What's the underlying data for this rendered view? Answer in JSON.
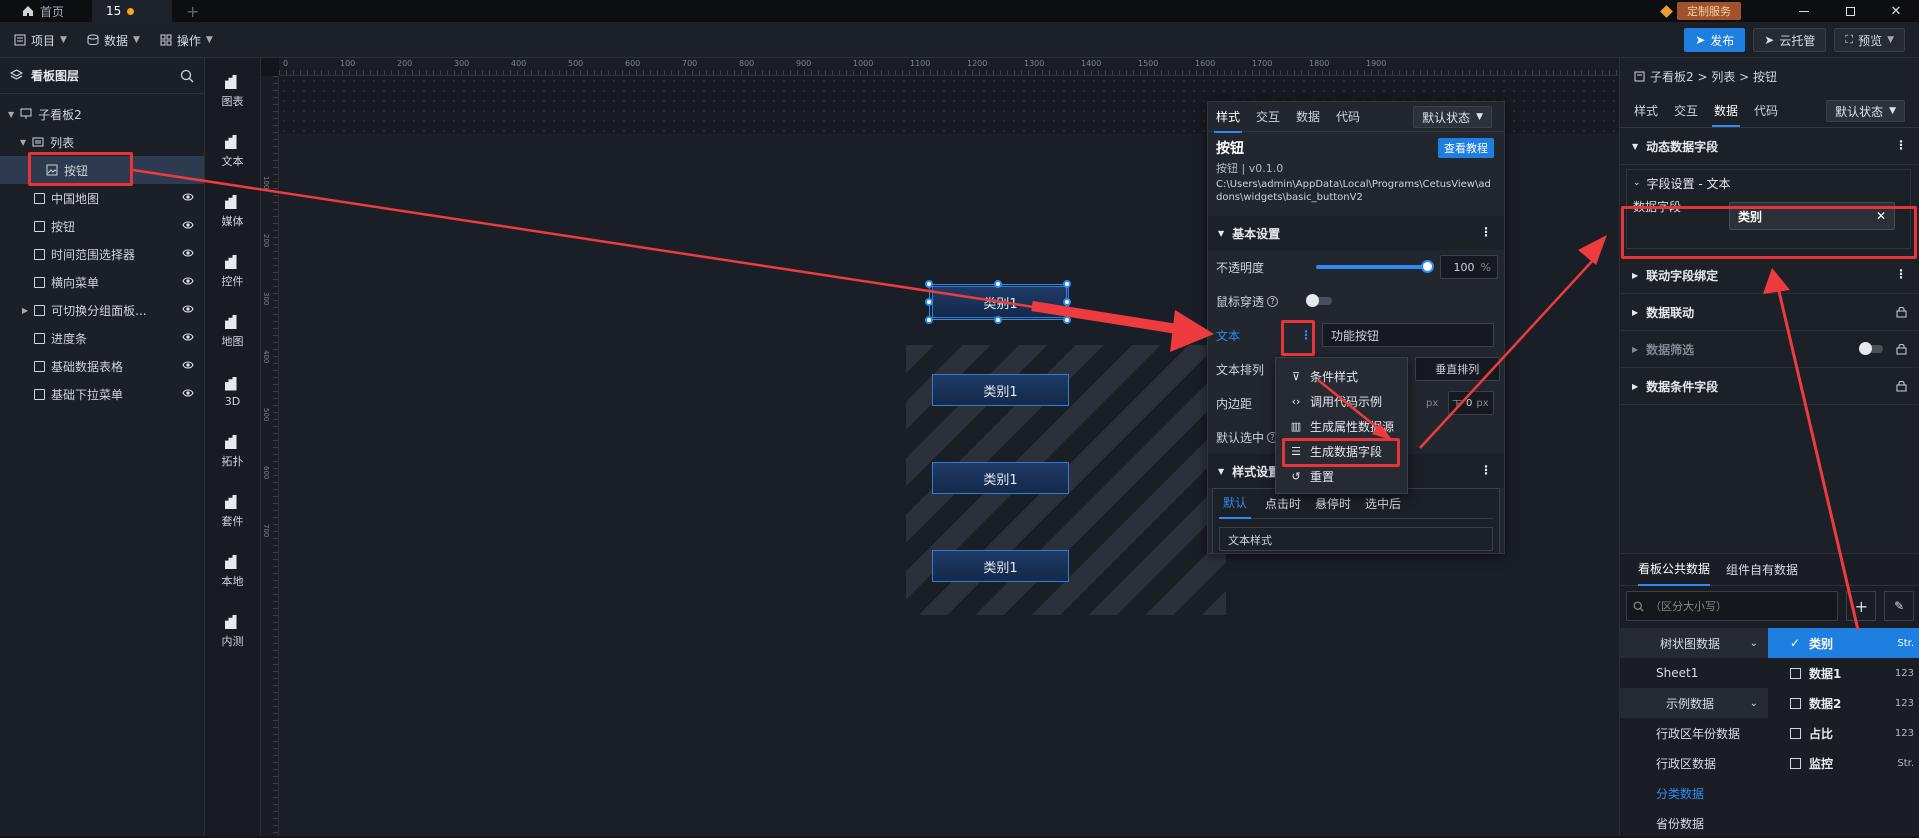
{
  "titlebar": {
    "tabs": [
      {
        "label": "首页"
      },
      {
        "label": "15"
      }
    ],
    "add_tab": "+",
    "service_label": "定制服务"
  },
  "menubar": {
    "items": [
      {
        "label": "项目"
      },
      {
        "label": "数据"
      },
      {
        "label": "操作"
      }
    ],
    "publish": "发布",
    "cloud": "云托管",
    "preview": "预览"
  },
  "layers": {
    "title": "看板图层",
    "root": "子看板2",
    "list": "列表",
    "selected_item": "按钮",
    "items": [
      {
        "label": "中国地图"
      },
      {
        "label": "按钮"
      },
      {
        "label": "时间范围选择器"
      },
      {
        "label": "横向菜单"
      },
      {
        "label": "可切换分组面板..."
      },
      {
        "label": "进度条"
      },
      {
        "label": "基础数据表格"
      },
      {
        "label": "基础下拉菜单"
      }
    ]
  },
  "toolbox": {
    "items": [
      {
        "label": "图表",
        "icon": "chart-icon"
      },
      {
        "label": "文本",
        "icon": "text-icon"
      },
      {
        "label": "媒体",
        "icon": "media-icon"
      },
      {
        "label": "控件",
        "icon": "widget-icon"
      },
      {
        "label": "地图",
        "icon": "map-icon"
      },
      {
        "label": "3D",
        "icon": "cube-icon"
      },
      {
        "label": "拓扑",
        "icon": "topology-icon"
      },
      {
        "label": "套件",
        "icon": "kit-icon"
      },
      {
        "label": "本地",
        "icon": "puzzle-icon"
      },
      {
        "label": "内测",
        "icon": "beta-chart-icon"
      }
    ]
  },
  "ruler": {
    "top": [
      "0",
      "100",
      "200",
      "300",
      "400",
      "500",
      "600",
      "700",
      "800",
      "900",
      "1000",
      "1100",
      "1200",
      "1300",
      "1400",
      "1500",
      "1600",
      "1700",
      "1800",
      "1900"
    ],
    "left": [
      "100",
      "200",
      "300",
      "400",
      "500",
      "600",
      "700"
    ]
  },
  "canvas": {
    "selected_button": "类别1",
    "buttons": [
      {
        "label": "类别1"
      },
      {
        "label": "类别1"
      },
      {
        "label": "类别1"
      }
    ]
  },
  "floatpanel": {
    "tabs": [
      {
        "label": "样式"
      },
      {
        "label": "交互"
      },
      {
        "label": "数据"
      },
      {
        "label": "代码"
      }
    ],
    "state": "默认状态",
    "title": "按钮",
    "tutorial": "查看教程",
    "subtitle": "按钮 | v0.1.0",
    "path": "C:\\Users\\admin\\AppData\\Local\\Programs\\CetusView\\addons\\widgets\\basic_buttonV2",
    "section_basic": "基本设置",
    "opacity_label": "不透明度",
    "opacity_value": "100",
    "opacity_unit": "%",
    "opacity_fraction": 1.0,
    "mouse_through": "鼠标穿透",
    "text_label": "文本",
    "text_value": "功能按钮",
    "text_layout": "文本排列",
    "vertical": "垂直排列",
    "padding": "内边距",
    "padding_unit": "px",
    "padding_bottom": "下",
    "padding_value": "0",
    "default_selected": "默认选中",
    "section_style": "样式设置",
    "style_tabs": [
      {
        "label": "默认"
      },
      {
        "label": "点击时"
      },
      {
        "label": "悬停时"
      },
      {
        "label": "选中后"
      }
    ],
    "style_sub": "文本样式"
  },
  "context_menu": {
    "items": [
      {
        "label": "条件样式",
        "icon": "filter-icon"
      },
      {
        "label": "调用代码示例",
        "icon": "code-icon"
      },
      {
        "label": "生成属性数据源",
        "icon": "chart-data-icon"
      },
      {
        "label": "生成数据字段",
        "icon": "database-icon"
      },
      {
        "label": "重置",
        "icon": "reset-icon"
      }
    ]
  },
  "rpanel": {
    "breadcrumb": "子看板2 > 列表 > 按钮",
    "tabs": [
      {
        "label": "样式"
      },
      {
        "label": "交互"
      },
      {
        "label": "数据"
      },
      {
        "label": "代码"
      }
    ],
    "state": "默认状态",
    "sections": {
      "dynamic": "动态数据字段",
      "field_setting": "字段设置 - 文本",
      "data_field": "数据字段",
      "data_field_value": "类别",
      "link_binding": "联动字段绑定",
      "data_link": "数据联动",
      "data_filter": "数据筛选",
      "data_condition": "数据条件字段"
    },
    "bottom_tabs": [
      {
        "label": "看板公共数据"
      },
      {
        "label": "组件自有数据"
      }
    ],
    "search_placeholder": "（区分大小写）",
    "datasets": [
      {
        "label": "树状图数据"
      },
      {
        "label": "Sheet1"
      },
      {
        "label": "示例数据"
      },
      {
        "label": "行政区年份数据"
      },
      {
        "label": "行政区数据"
      },
      {
        "label": "分类数据"
      },
      {
        "label": "省份数据"
      }
    ],
    "fields": [
      {
        "label": "类别",
        "type": "Str."
      },
      {
        "label": "数据1",
        "type": "123"
      },
      {
        "label": "数据2",
        "type": "123"
      },
      {
        "label": "占比",
        "type": "123"
      },
      {
        "label": "监控",
        "type": "Str."
      }
    ]
  },
  "colors": {
    "accent": "#2d8cf0",
    "highlight": "#e5343a",
    "arrow": "#ee3b3f",
    "canvas_bg": "#1a1e26"
  }
}
